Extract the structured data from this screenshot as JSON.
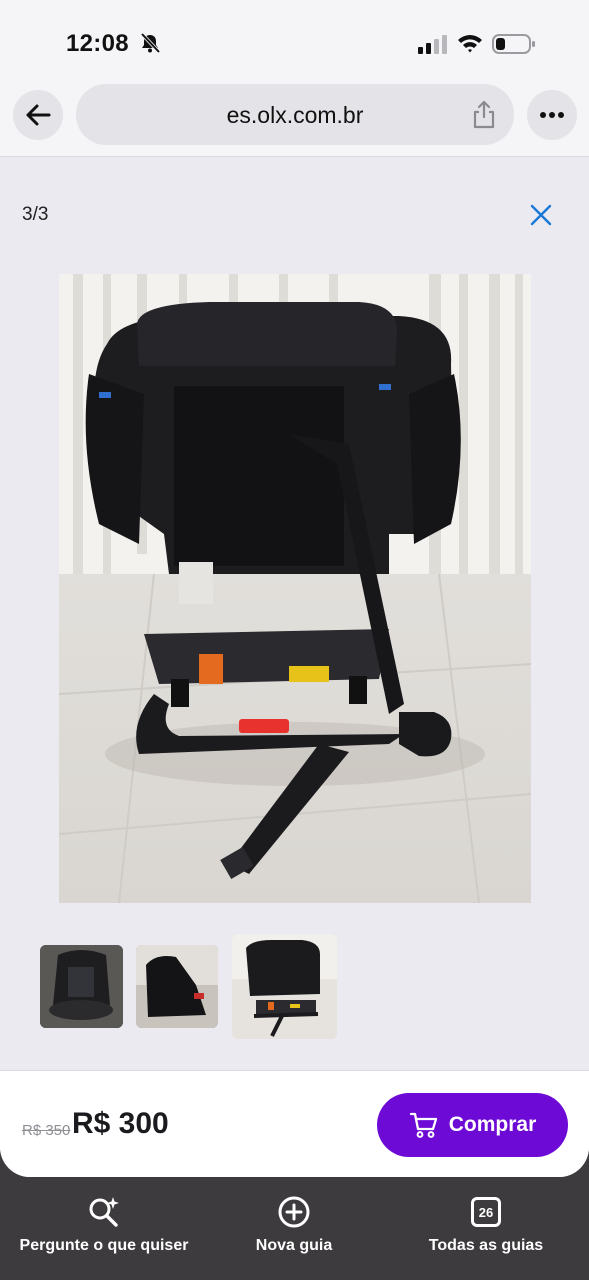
{
  "status_bar": {
    "time": "12:08"
  },
  "browser": {
    "url": "es.olx.com.br"
  },
  "gallery": {
    "counter": "3/3",
    "thumbnails": [
      {
        "name": "car-seat-front-view"
      },
      {
        "name": "car-seat-side-view"
      },
      {
        "name": "car-seat-back-view",
        "selected": true
      }
    ]
  },
  "purchase": {
    "old_price": "R$ 350",
    "price": "R$ 300",
    "buy_label": "Comprar",
    "accent_color": "#6e0ad6"
  },
  "toolbar": {
    "ask_label": "Pergunte o que quiser",
    "new_tab_label": "Nova guia",
    "tab_count": "26",
    "all_tabs_label": "Todas as guias"
  }
}
